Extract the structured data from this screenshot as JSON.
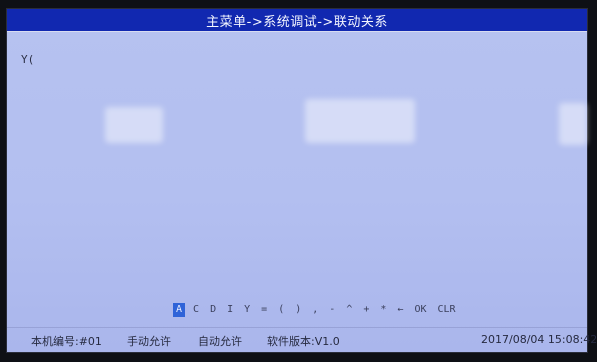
{
  "title": "主菜单->系统调试->联动关系",
  "editor": {
    "text": "Y("
  },
  "keyboard": {
    "keys": [
      "A",
      "C",
      "D",
      "I",
      "Y",
      "=",
      "(",
      ")",
      ",",
      "-",
      "^",
      "+",
      "*",
      "←",
      "OK",
      "CLR"
    ],
    "selected_index": 0
  },
  "status": {
    "machine_number": "本机编号:#01",
    "manual": "手动允许",
    "auto": "自动允许",
    "version": "软件版本:V1.0",
    "datetime": "2017/08/04 15:08:42"
  },
  "colors": {
    "titlebar": "#1128b0",
    "screen": "#b4c0f0",
    "selected_key": "#2f63d8"
  }
}
